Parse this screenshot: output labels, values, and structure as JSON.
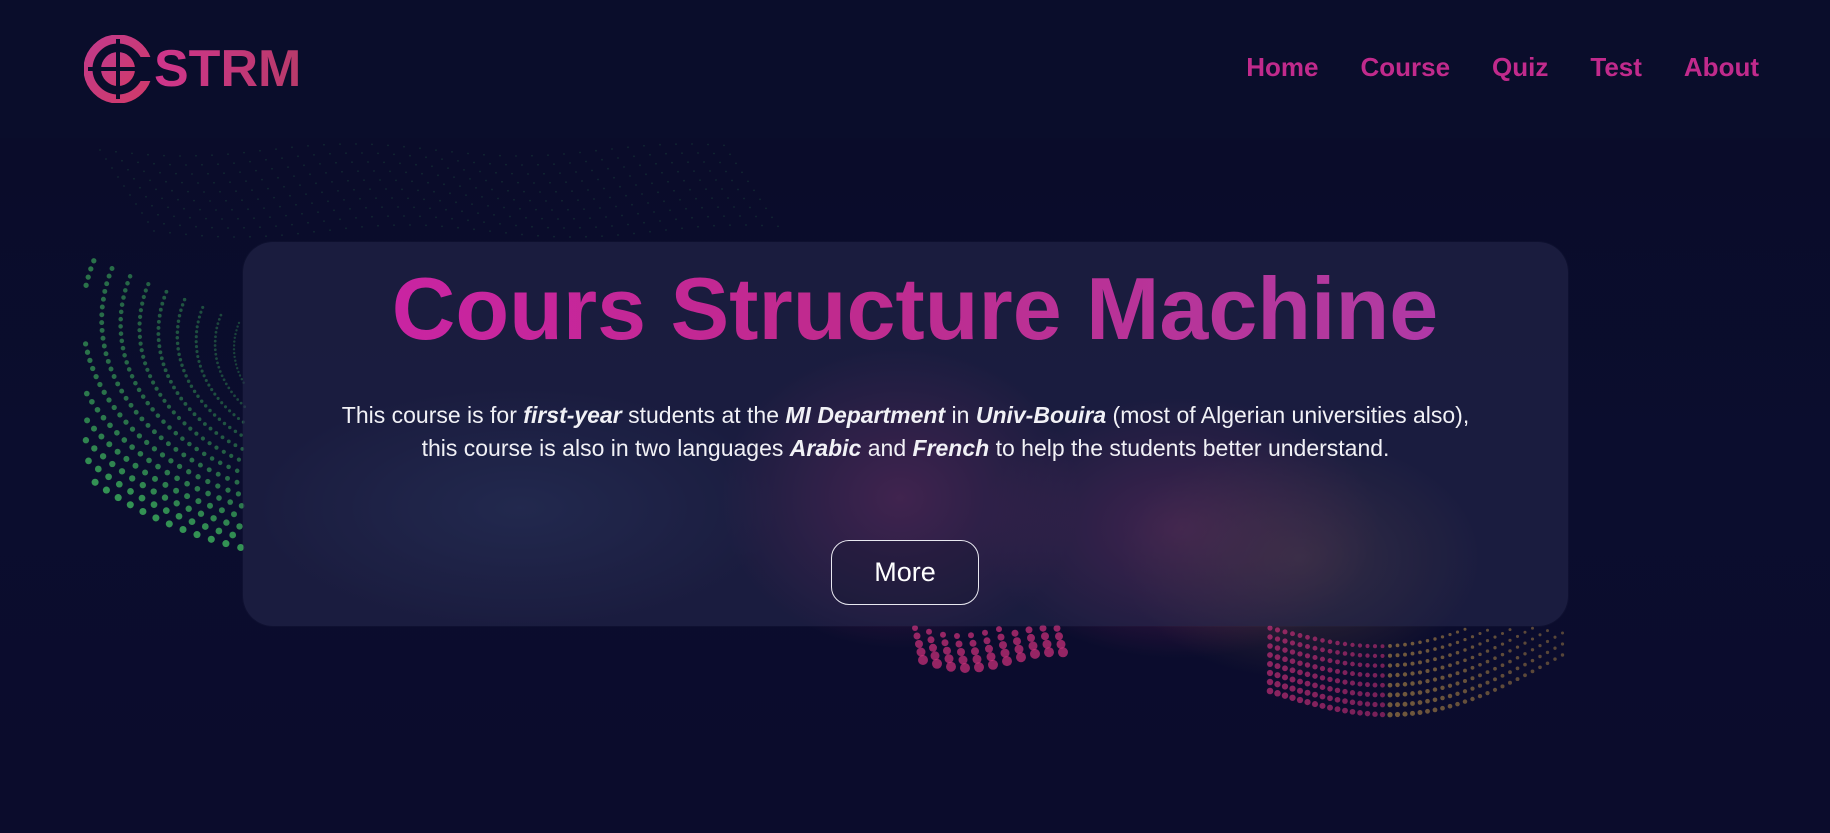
{
  "header": {
    "logo_text": "STRM",
    "nav": [
      "Home",
      "Course",
      "Quiz",
      "Test",
      "About"
    ]
  },
  "hero": {
    "title": "Cours Structure Machine",
    "line1": {
      "t1": "This course is for ",
      "b1": "first-year",
      "t2": " students at the ",
      "b2": "MI Department",
      "t3": " in ",
      "b3": "Univ-Bouira",
      "t4": " (most of Algerian universities also),"
    },
    "line2": {
      "t1": "this course is also in two languages ",
      "b1": "Arabic",
      "t2": " and ",
      "b2": "French",
      "t3": " to help the students better understand."
    },
    "button_label": "More"
  },
  "colors": {
    "background": "#0a0c2a",
    "nav": "#c12a8c",
    "title_start": "#d21fb4",
    "title_end": "#a42ad9",
    "dots_green": "#3aa65a",
    "dots_pink": "#d0307c",
    "dots_gold": "#c89a4a"
  },
  "icons": {
    "logo": "strm-logo-icon"
  }
}
